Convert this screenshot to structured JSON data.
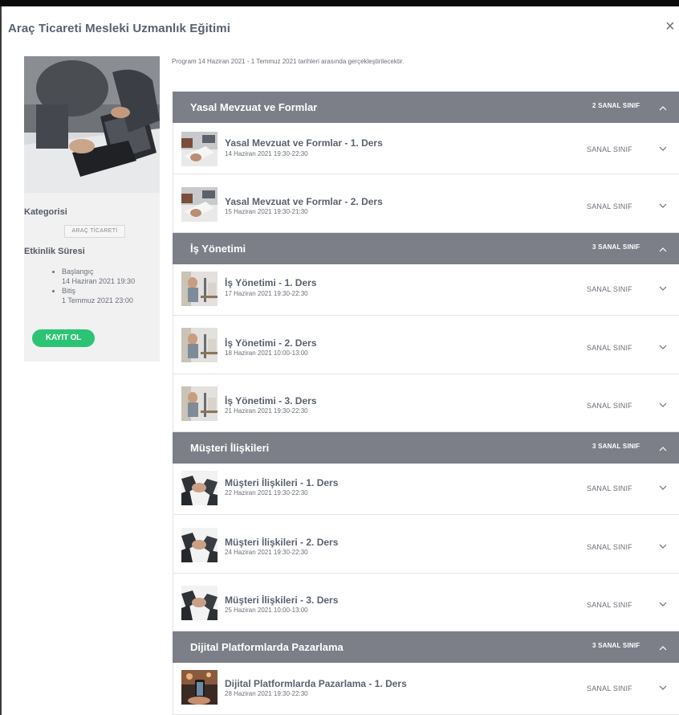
{
  "modal": {
    "title": "Araç Ticareti Mesleki Uzmanlık Eğitimi",
    "close_glyph": "×"
  },
  "sidebar": {
    "category_label": "Kategorisi",
    "category_value": "ARAÇ TİCARETİ",
    "duration_label": "Etkinlik Süresi",
    "start_label": "Başlangıç",
    "start_value": "14 Haziran 2021 19:30",
    "end_label": "Bitiş",
    "end_value": "1 Temmuz 2021 23:00",
    "enroll_label": "KAYIT OL"
  },
  "program_note": "Program 14 Haziran 2021 - 1 Temmuz 2021 tarihleri arasında gerçekleştirilecektir.",
  "sections": [
    {
      "title": "Yasal Mevzuat ve Formlar",
      "count": "2 SANAL SINIF",
      "lessons": [
        {
          "title": "Yasal Mevzuat ve Formlar - 1. Ders",
          "date": "14 Haziran 2021 19:30-22:30",
          "type": "SANAL SINIF"
        },
        {
          "title": "Yasal Mevzuat ve Formlar - 2. Ders",
          "date": "15 Haziran 2021 19:30-21:30",
          "type": "SANAL SINIF"
        }
      ]
    },
    {
      "title": "İş Yönetimi",
      "count": "3 SANAL SINIF",
      "lessons": [
        {
          "title": "İş Yönetimi - 1. Ders",
          "date": "17 Haziran 2021 19:30-22:30",
          "type": "SANAL SINIF"
        },
        {
          "title": "İş Yönetimi - 2. Ders",
          "date": "18 Haziran 2021 10:00-13:00",
          "type": "SANAL SINIF"
        },
        {
          "title": "İş Yönetimi - 3. Ders",
          "date": "21 Haziran 2021 19:30-22:30",
          "type": "SANAL SINIF"
        }
      ]
    },
    {
      "title": "Müşteri İlişkileri",
      "count": "3 SANAL SINIF",
      "lessons": [
        {
          "title": "Müşteri İlişkileri - 1. Ders",
          "date": "22 Haziran 2021 19:30-22:30",
          "type": "SANAL SINIF"
        },
        {
          "title": "Müşteri İlişkileri - 2. Ders",
          "date": "24 Haziran 2021 19:30-22:30",
          "type": "SANAL SINIF"
        },
        {
          "title": "Müşteri İlişkileri - 3. Ders",
          "date": "25 Haziran 2021 10:00-13:00",
          "type": "SANAL SINIF"
        }
      ]
    },
    {
      "title": "Dijital Platformlarda Pazarlama",
      "count": "3 SANAL SINIF",
      "lessons": [
        {
          "title": "Dijital Platformlarda Pazarlama - 1. Ders",
          "date": "28 Haziran 2021 19:30-22:30",
          "type": "SANAL SINIF"
        }
      ]
    }
  ],
  "colors": {
    "section_header_bg": "#7c7f88",
    "enroll_button": "#2cc474",
    "title_text": "#5a6170"
  },
  "icons": {
    "close": "close-icon",
    "section_toggle": "chevron-up-icon",
    "lesson_toggle": "chevron-down-icon"
  }
}
